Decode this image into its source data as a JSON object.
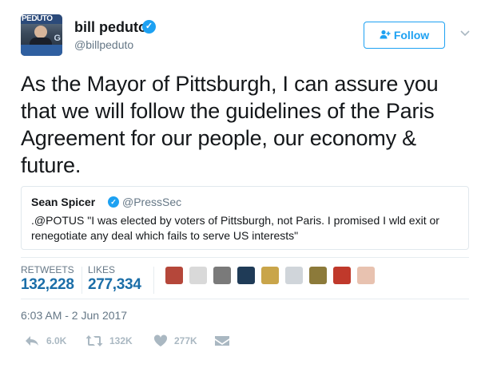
{
  "tweet": {
    "author": {
      "name": "bill peduto",
      "handle": "@billpeduto",
      "avatar_text": "PEDUTO",
      "avatar_extra": "G",
      "verified_icon": "verified-badge"
    },
    "follow_label": "Follow",
    "text": "As the Mayor of Pittsburgh, I can assure you that we will follow the guidelines of the Paris Agreement for our people, our economy & future.",
    "quoted": {
      "name": "Sean Spicer",
      "handle": "@PressSec",
      "text": ".@POTUS \"I was elected by voters of Pittsburgh, not Paris. I promised I wld exit or renegotiate any deal which fails to serve US interests\""
    },
    "stats": {
      "retweets_label": "RETWEETS",
      "retweets_value": "132,228",
      "likes_label": "LIKES",
      "likes_value": "277,334"
    },
    "likers": [
      "#b5473a",
      "#d9d9d9",
      "#7a7a7a",
      "#1f3b57",
      "#c9a54a",
      "#d0d5da",
      "#8c7a3a",
      "#c0392b",
      "#e8c2b0"
    ],
    "timestamp": "6:03 AM - 2 Jun 2017",
    "actions": {
      "reply": "6.0K",
      "retweet": "132K",
      "like": "277K"
    },
    "colors": {
      "accent": "#1da1f2",
      "stat_value": "#1b6ea8",
      "muted": "#657786",
      "icon_muted": "#aab8c2"
    }
  }
}
